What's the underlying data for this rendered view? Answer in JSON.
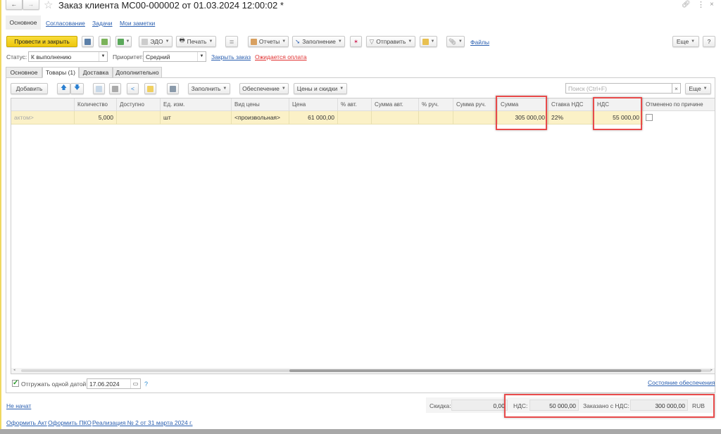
{
  "window": {
    "title": "Заказ клиента МС00-000002 от 01.03.2024 12:00:02 *"
  },
  "nav": {
    "tabs": [
      {
        "label": "Основное"
      },
      {
        "label": "Согласование"
      },
      {
        "label": "Задачи"
      },
      {
        "label": "Мои заметки"
      }
    ]
  },
  "toolbar": {
    "post_close": "Провести и закрыть",
    "edo": "ЭДО",
    "print": "Печать",
    "reports": "Отчеты",
    "fill": "Заполнение",
    "send": "Отправить",
    "files": "Файлы",
    "more": "Еще",
    "help": "?"
  },
  "status": {
    "status_label": "Статус:",
    "status_value": "К выполнению",
    "priority_label": "Приоритет:",
    "priority_value": "Средний",
    "close_order": "Закрыть заказ",
    "awaiting_payment": "Ожидается оплата"
  },
  "tabs": [
    {
      "label": "Основное"
    },
    {
      "label": "Товары (1)"
    },
    {
      "label": "Доставка"
    },
    {
      "label": "Дополнительно"
    }
  ],
  "goods_toolbar": {
    "add": "Добавить",
    "fill": "Заполнить",
    "supply": "Обеспечение",
    "prices": "Цены и скидки",
    "search_placeholder": "Поиск (Ctrl+F)",
    "clear": "×",
    "more": "Еще"
  },
  "table": {
    "columns": [
      "",
      "Количество",
      "Доступно",
      "Ед. изм.",
      "Вид цены",
      "Цена",
      "% авт.",
      "Сумма авт.",
      "% руч.",
      "Сумма руч.",
      "Сумма",
      "Ставка НДС",
      "НДС",
      "Отменено по причине"
    ],
    "rows": [
      {
        "c0": "актом>",
        "c1": "5,000",
        "c2": "",
        "c3": "шт",
        "c4": "<произвольная>",
        "c5": "61 000,00",
        "c6": "",
        "c7": "",
        "c8": "",
        "c9": "",
        "c10": "305 000,00",
        "c11": "22%",
        "c12": "55 000,00",
        "cancelled": false
      }
    ]
  },
  "shipping": {
    "checked": true,
    "label": "Отгружать одной датой",
    "date": "17.06.2024",
    "help": "?",
    "supply_state": "Состояние обеспечения"
  },
  "footer": {
    "state": "Не начат",
    "discount_label": "Скидка:",
    "discount": "0,00",
    "vat_label": "НДС:",
    "vat": "50 000,00",
    "ordered_label": "Заказано с НДС:",
    "ordered": "300 000,00",
    "currency": "RUB",
    "links": [
      "Оформить Акт",
      "Оформить ПКО",
      "Реализация № 2 от 31 марта 2024 г."
    ]
  },
  "colors": {
    "primary_button": "#f5d31a",
    "highlight_row": "#fbf1c7",
    "annotation": "#e84a4a",
    "link": "#2a5fb0",
    "warning_link": "#e03030"
  }
}
